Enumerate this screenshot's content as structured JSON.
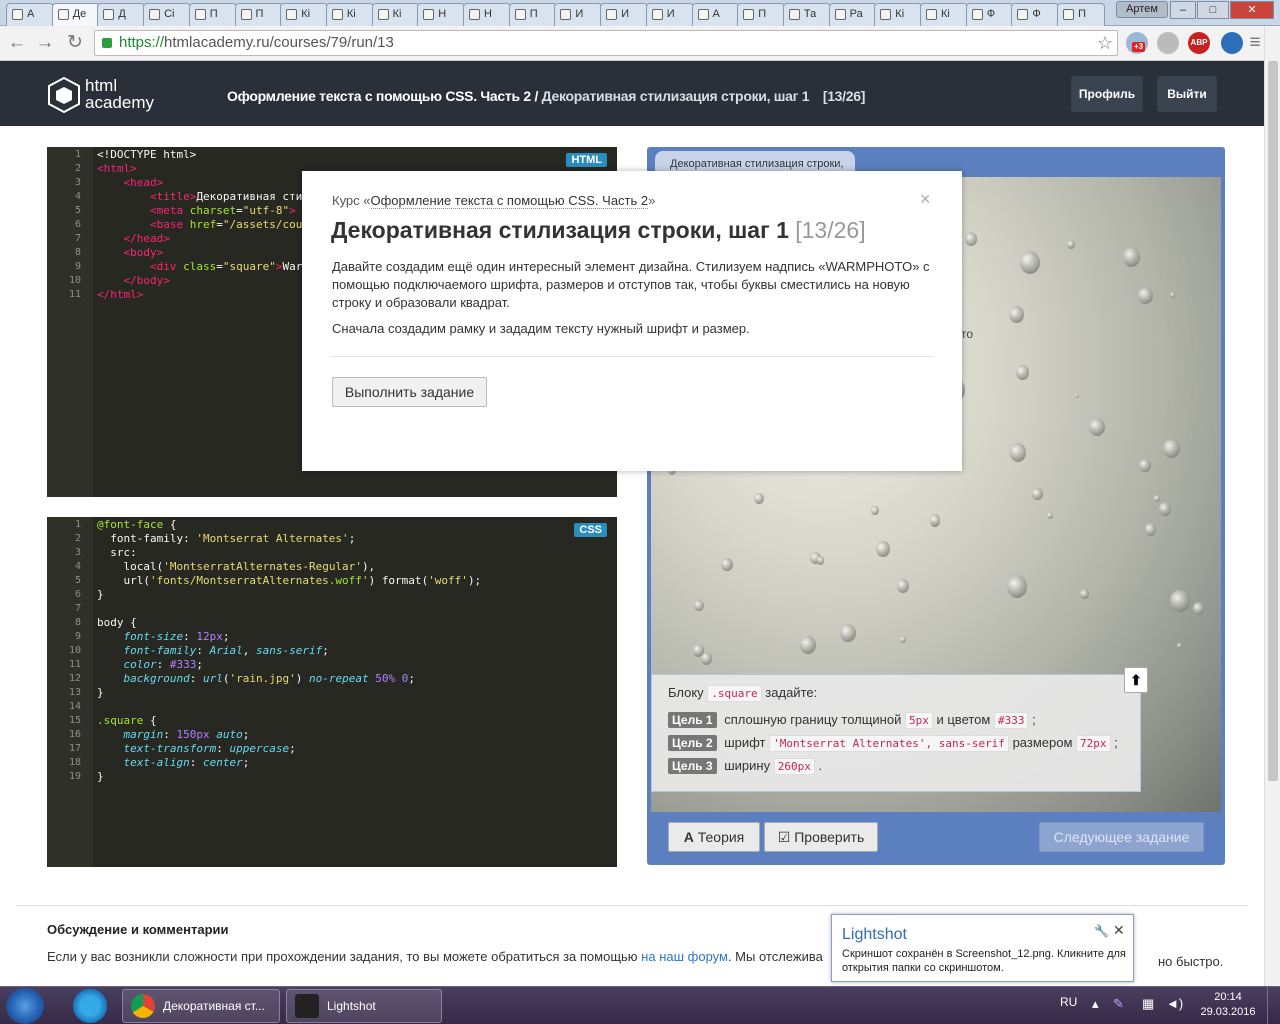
{
  "browser": {
    "tabs": [
      {
        "label": "A"
      },
      {
        "label": "Де"
      },
      {
        "label": "Д"
      },
      {
        "label": "Сі"
      },
      {
        "label": "П"
      },
      {
        "label": "П"
      },
      {
        "label": "Кі"
      },
      {
        "label": "Кі"
      },
      {
        "label": "Кі"
      },
      {
        "label": "Н"
      },
      {
        "label": "Н"
      },
      {
        "label": "П"
      },
      {
        "label": "И"
      },
      {
        "label": "И"
      },
      {
        "label": "И"
      },
      {
        "label": "А"
      },
      {
        "label": "П"
      },
      {
        "label": "Та"
      },
      {
        "label": "Ра"
      },
      {
        "label": "Кі"
      },
      {
        "label": "Кі"
      },
      {
        "label": "Ф"
      },
      {
        "label": "Ф"
      },
      {
        "label": "П"
      }
    ],
    "user_label": "Артем",
    "url_scheme": "https://",
    "url_rest": "htmlacademy.ru/courses/79/run/13",
    "ext_badge": "+3",
    "abp_label": "ABP"
  },
  "header": {
    "logo_line1": "html",
    "logo_line2": "academy",
    "course_name": "Оформление текста с помощью CSS. Часть 2 /",
    "lesson_name": "Декоративная стилизация строки, шаг 1",
    "progress": "[13/26]",
    "profile_button": "Профиль",
    "logout_button": "Выйти"
  },
  "html_editor": {
    "badge": "HTML",
    "line_numbers": [
      "1",
      "2",
      "3",
      "4",
      "5",
      "6",
      "7",
      "8",
      "9",
      "10",
      "11"
    ]
  },
  "css_editor": {
    "badge": "CSS",
    "line_numbers": [
      "1",
      "2",
      "3",
      "4",
      "5",
      "6",
      "7",
      "8",
      "9",
      "10",
      "11",
      "12",
      "13",
      "14",
      "15",
      "16",
      "17",
      "18",
      "19"
    ]
  },
  "preview": {
    "tab_label": "Декоративная стилизация строки,",
    "ghost_text": "то",
    "task_intro_prefix": "Блоку",
    "task_intro_code": ".square",
    "task_intro_suffix": "задайте:",
    "goals": [
      {
        "label": "Цель 1",
        "text1": "сплошную границу толщиной",
        "code1": "5px",
        "text2": "и цветом",
        "code2": "#333",
        "text3": ";"
      },
      {
        "label": "Цель 2",
        "text1": "шрифт",
        "code1": "'Montserrat Alternates', sans-serif",
        "text2": "размером",
        "code2": "72px",
        "text3": ";"
      },
      {
        "label": "Цель 3",
        "text1": "ширину",
        "code1": "260px",
        "text2": ".",
        "code2": "",
        "text3": ""
      }
    ],
    "theory_button": "Теория",
    "check_button": "Проверить",
    "next_button": "Следующее задание"
  },
  "discussion": {
    "heading": "Обсуждение и комментарии",
    "text_before": "Если у вас возникли сложности при прохождении задания, то вы можете обратиться за помощью",
    "link": "на наш форум",
    "text_after": ". Мы отслежива",
    "text_tail": "но быстро."
  },
  "modal": {
    "course_prefix": "Курс «",
    "course_link": "Оформление текста с помощью CSS. Часть 2",
    "course_suffix": "»",
    "title": "Декоративная стилизация строки, шаг 1",
    "step": "[13/26]",
    "paragraph1": "Давайте создадим ещё один интересный элемент дизайна. Стилизуем надпись «WARMPHOTO» с помощью подключаемого шрифта, размеров и отступов так, чтобы буквы сместились на новую строку и образовали квадрат.",
    "paragraph2": "Сначала создадим рамку и зададим тексту нужный шрифт и размер.",
    "run_button": "Выполнить задание",
    "close": "×"
  },
  "lightshot": {
    "title": "Lightshot",
    "message": "Скриншот сохранён в Screenshot_12.png. Кликните для открытия папки со скриншотом."
  },
  "taskbar": {
    "chrome_task": "Декоративная ст...",
    "lightshot_task": "Lightshot",
    "lang": "RU",
    "time": "20:14",
    "date": "29.03.2016"
  },
  "colors": {
    "header_bg": "#293039",
    "editor_bg": "#272822",
    "preview_frame": "#5b7fbf",
    "html_badge": "#2b8cbe",
    "link": "#2a78c6"
  }
}
